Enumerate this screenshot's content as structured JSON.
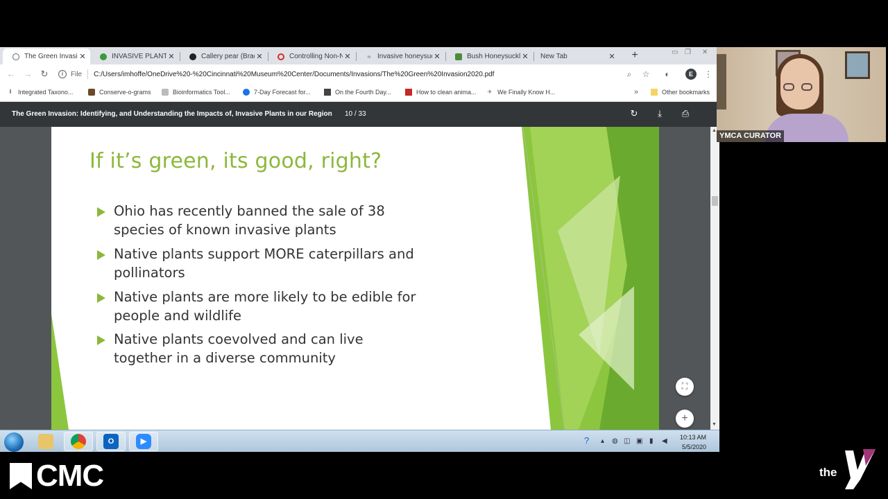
{
  "tabs": [
    {
      "title": "The Green Invasion",
      "active": true
    },
    {
      "title": "INVASIVE PLANTS",
      "active": false
    },
    {
      "title": "Callery pear (Bradfo",
      "active": false
    },
    {
      "title": "Controlling Non-N",
      "active": false
    },
    {
      "title": "Invasive honeysuck",
      "active": false
    },
    {
      "title": "Bush Honeysuckle",
      "active": false
    },
    {
      "title": "New Tab",
      "active": false
    }
  ],
  "toolbar": {
    "file_label": "File",
    "url": "C:/Users/imhoffe/OneDrive%20-%20Cincinnati%20Museum%20Center/Documents/Invasions/The%20Green%20Invasion2020.pdf",
    "profile_initial": "E"
  },
  "bookmarks": {
    "items": [
      "Integrated Taxono...",
      "Conserve-o-grams",
      "Bioinformatics Tool...",
      "7-Day Forecast for...",
      "On the Fourth Day...",
      "How to clean anima...",
      "We Finally Know H..."
    ],
    "other": "Other bookmarks"
  },
  "pdf": {
    "title": "The Green Invasion: Identifying, and Understanding the Impacts of, Invasive Plants in our Region",
    "page_current": "10",
    "page_total": "33",
    "page_display": "10 / 33"
  },
  "slide": {
    "title": "If it’s green, its good, right?",
    "bullets": [
      {
        "line1": "Ohio has recently banned the sale of 38",
        "line2": "species of known invasive plants"
      },
      {
        "line1": "Native plants support MORE caterpillars and",
        "line2": "pollinators"
      },
      {
        "line1": "Native plants are more likely to be edible for",
        "line2": "people and wildlife"
      },
      {
        "line1": "Native plants coevolved and can live",
        "line2": "together in a diverse community"
      }
    ]
  },
  "taskbar": {
    "time": "10:13 AM",
    "date": "5/5/2020"
  },
  "webcam": {
    "name": "YMCA CURATOR"
  },
  "branding": {
    "left_logo": "CMC",
    "right_logo_text": "the"
  },
  "colors": {
    "slide_accent": "#8cb83a",
    "pdf_toolbar": "#323639",
    "pdf_background": "#525659",
    "ymca_purple": "#a0357a"
  }
}
